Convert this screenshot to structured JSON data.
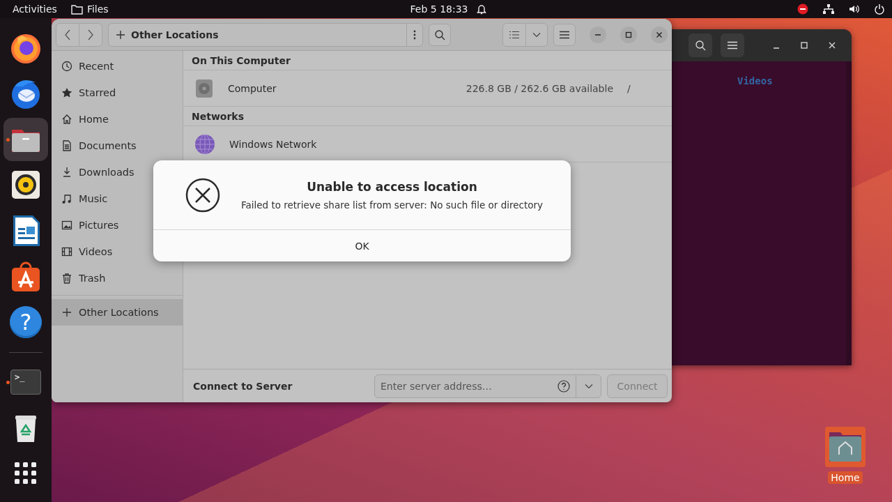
{
  "top_bar": {
    "activities": "Activities",
    "app_name": "Files",
    "clock": "Feb 5  18:33"
  },
  "dock": [
    {
      "kind": "firefox",
      "running": false,
      "selected": false
    },
    {
      "kind": "thunderbird",
      "running": false,
      "selected": false
    },
    {
      "kind": "files",
      "running": true,
      "selected": true
    },
    {
      "kind": "rhythmbox",
      "running": false,
      "selected": false
    },
    {
      "kind": "writer",
      "running": false,
      "selected": false
    },
    {
      "kind": "appcenter",
      "running": false,
      "selected": false
    },
    {
      "kind": "help",
      "glyph": "?",
      "running": false,
      "selected": false
    },
    {
      "kind": "terminal",
      "glyph": ">_",
      "running": true,
      "selected": false
    },
    {
      "kind": "trash",
      "running": false,
      "selected": false
    },
    {
      "kind": "apps",
      "running": false,
      "selected": false
    }
  ],
  "files_window": {
    "path": "Other Locations",
    "sidebar": {
      "items": [
        {
          "label": "Recent",
          "kind": "recent",
          "selected": false
        },
        {
          "label": "Starred",
          "kind": "starred",
          "selected": false
        },
        {
          "label": "Home",
          "kind": "home",
          "selected": false
        },
        {
          "label": "Documents",
          "kind": "documents",
          "selected": false
        },
        {
          "label": "Downloads",
          "kind": "downloads",
          "selected": false
        },
        {
          "label": "Music",
          "kind": "music",
          "selected": false
        },
        {
          "label": "Pictures",
          "kind": "pictures",
          "selected": false
        },
        {
          "label": "Videos",
          "kind": "videos",
          "selected": false
        },
        {
          "label": "Trash",
          "kind": "trash",
          "selected": false
        }
      ],
      "extra_items": [
        {
          "label": "Other Locations",
          "kind": "other",
          "selected": true
        }
      ]
    },
    "sections": [
      {
        "title": "On This Computer",
        "items": [
          {
            "name": "Computer",
            "kind": "drive",
            "info": "226.8 GB / 262.6 GB available",
            "path": "/"
          }
        ]
      },
      {
        "title": "Networks",
        "items": [
          {
            "name": "Windows Network",
            "kind": "network"
          }
        ]
      }
    ],
    "connect": {
      "label": "Connect to Server",
      "placeholder": "Enter server address…",
      "button": "Connect",
      "button_disabled": true
    }
  },
  "dialog": {
    "title": "Unable to access location",
    "message": "Failed to retrieve share list from server: No such file or directory",
    "button": "OK"
  },
  "terminal": {
    "text": "Videos"
  },
  "desktop_icons": [
    {
      "label": "Home"
    }
  ]
}
